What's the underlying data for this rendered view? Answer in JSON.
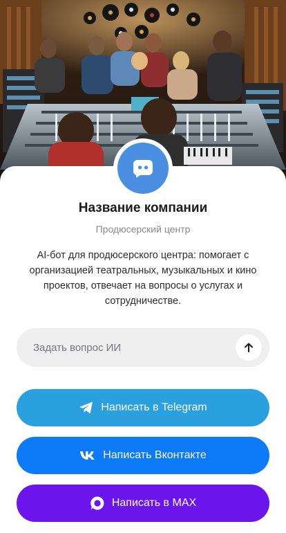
{
  "hero": {
    "image": "music-studio-photo"
  },
  "profile": {
    "avatar_icon": "chat-bot-icon",
    "name": "Название компании",
    "subtitle": "Продюсерский центр",
    "description": "AI-бот для продюсерского центра: помогает с организацией театральных, музыкальных и кино проектов, отвечает на вопросы о услугах и сотрудничестве."
  },
  "ask": {
    "placeholder": "Задать вопрос ИИ",
    "send_icon": "arrow-up-icon"
  },
  "buttons": {
    "telegram": {
      "label": "Написать в Telegram",
      "icon": "telegram-icon",
      "color": "#2aa1de"
    },
    "vk": {
      "label": "Написать Вконтакте",
      "icon": "vk-icon",
      "color": "#0d7af7"
    },
    "max": {
      "label": "Написать в MAX",
      "icon": "max-icon",
      "color": "#6b14ec"
    }
  },
  "colors": {
    "accent": "#4a8fe2",
    "input_bg": "#efeff0"
  }
}
